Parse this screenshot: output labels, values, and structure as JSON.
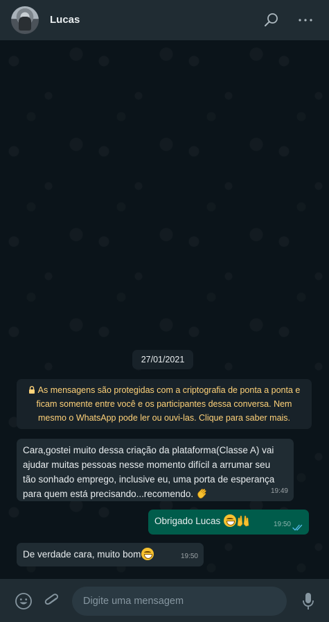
{
  "header": {
    "contact_name": "Lucas",
    "icons": [
      "avatar",
      "search-icon",
      "menu-icon"
    ]
  },
  "chat": {
    "date_chip": "27/01/2021",
    "encryption_notice": "As mensagens são protegidas com a criptografia de ponta a ponta e ficam somente entre você e os participantes dessa conversa. Nem mesmo o WhatsApp pode ler ou ouvi-las. Clique para saber mais.",
    "messages": [
      {
        "direction": "in",
        "text": "Cara,gostei muito dessa  criação da plataforma(Classe A) vai ajudar muitas pessoas nesse momento difícil a arrumar seu tão sonhado emprego, inclusive eu, uma porta de esperança para quem está precisando...recomendo.",
        "emoji": "clapping-hands",
        "time": "19:49"
      },
      {
        "direction": "out",
        "text": "Obrigado Lucas",
        "emoji": "grinning-face, raising-hands",
        "time": "19:50",
        "status": "read"
      },
      {
        "direction": "in",
        "text": "De verdade cara, muito bom",
        "emoji": "grinning-face",
        "time": "19:50"
      }
    ]
  },
  "composer": {
    "placeholder": "Digite uma mensagem"
  },
  "colors": {
    "header_bg": "#202c33",
    "chat_bg": "#0b141a",
    "incoming_bubble": "#202c33",
    "outgoing_bubble": "#005c4b",
    "notice_text": "#ffd279",
    "read_ticks": "#53bdeb"
  }
}
